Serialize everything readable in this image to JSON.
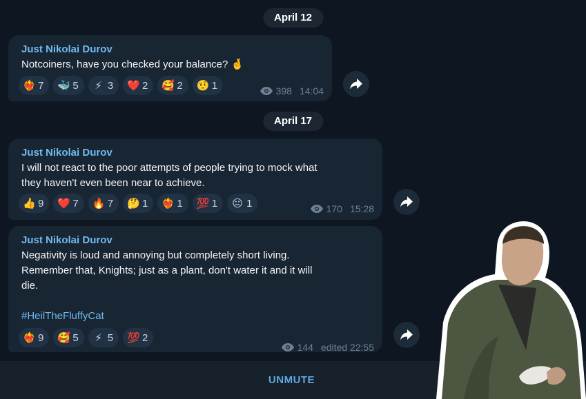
{
  "dates": [
    "April 12",
    "April 17"
  ],
  "messages": [
    {
      "author": "Just Nikolai Durov",
      "lines": [
        "Notcoiners, have you checked your balance? 🤞"
      ],
      "reactions": [
        {
          "emoji": "❤️‍🔥",
          "count": "7"
        },
        {
          "emoji": "🐳",
          "count": "5"
        },
        {
          "emoji": "⚡",
          "count": "3"
        },
        {
          "emoji": "❤️",
          "count": "2"
        },
        {
          "emoji": "🥰",
          "count": "2"
        },
        {
          "emoji": "🤨",
          "count": "1"
        }
      ],
      "views": "398",
      "time": "14:04"
    },
    {
      "author": "Just Nikolai Durov",
      "lines": [
        "I will not react to the poor attempts of people trying to mock what",
        "they haven't even been near to achieve."
      ],
      "reactions": [
        {
          "emoji": "👍",
          "count": "9"
        },
        {
          "emoji": "❤️",
          "count": "7"
        },
        {
          "emoji": "🔥",
          "count": "7"
        },
        {
          "emoji": "🤔",
          "count": "1"
        },
        {
          "emoji": "❤️‍🔥",
          "count": "1"
        },
        {
          "emoji": "💯",
          "count": "1"
        },
        {
          "emoji": "😐",
          "count": "1"
        }
      ],
      "views": "170",
      "time": "15:28"
    },
    {
      "author": "Just Nikolai Durov",
      "lines": [
        "Negativity is loud and annoying but completely short living.",
        "Remember that, Knights; just as a plant, don't water it and it will",
        "die."
      ],
      "hashtag": "#HeilTheFluffyCat",
      "reactions": [
        {
          "emoji": "❤️‍🔥",
          "count": "9"
        },
        {
          "emoji": "🥰",
          "count": "5"
        },
        {
          "emoji": "⚡",
          "count": "5"
        },
        {
          "emoji": "💯",
          "count": "2"
        }
      ],
      "views": "144",
      "time": "edited 22:55"
    }
  ],
  "bottom_bar": {
    "unmute_label": "UNMUTE"
  },
  "icons": {
    "views": "eye-icon",
    "forward": "forward-arrow-icon",
    "sticker": "man-eating-sticker"
  },
  "colors": {
    "background": "#0e1621",
    "bubble": "#182533",
    "accent": "#71baf0",
    "reaction_bg": "#213245"
  }
}
